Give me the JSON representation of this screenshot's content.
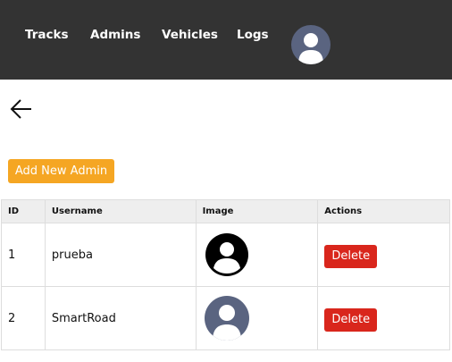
{
  "nav": {
    "items": [
      {
        "label": "Tracks"
      },
      {
        "label": "Admins"
      },
      {
        "label": "Vehicles"
      },
      {
        "label": "Logs"
      }
    ],
    "avatar_icon": "user-avatar-icon"
  },
  "back_icon": "arrow-left-icon",
  "add_button_label": "Add New Admin",
  "colors": {
    "navbar": "#333333",
    "accent": "#f5a623",
    "danger": "#d9261c"
  },
  "table": {
    "headers": [
      "ID",
      "Username",
      "Image",
      "Actions"
    ],
    "rows": [
      {
        "id": "1",
        "username": "prueba",
        "image_icon": "default-user-icon",
        "action": "Delete"
      },
      {
        "id": "2",
        "username": "SmartRoad",
        "image_icon": "user-avatar-icon",
        "action": "Delete"
      }
    ]
  }
}
